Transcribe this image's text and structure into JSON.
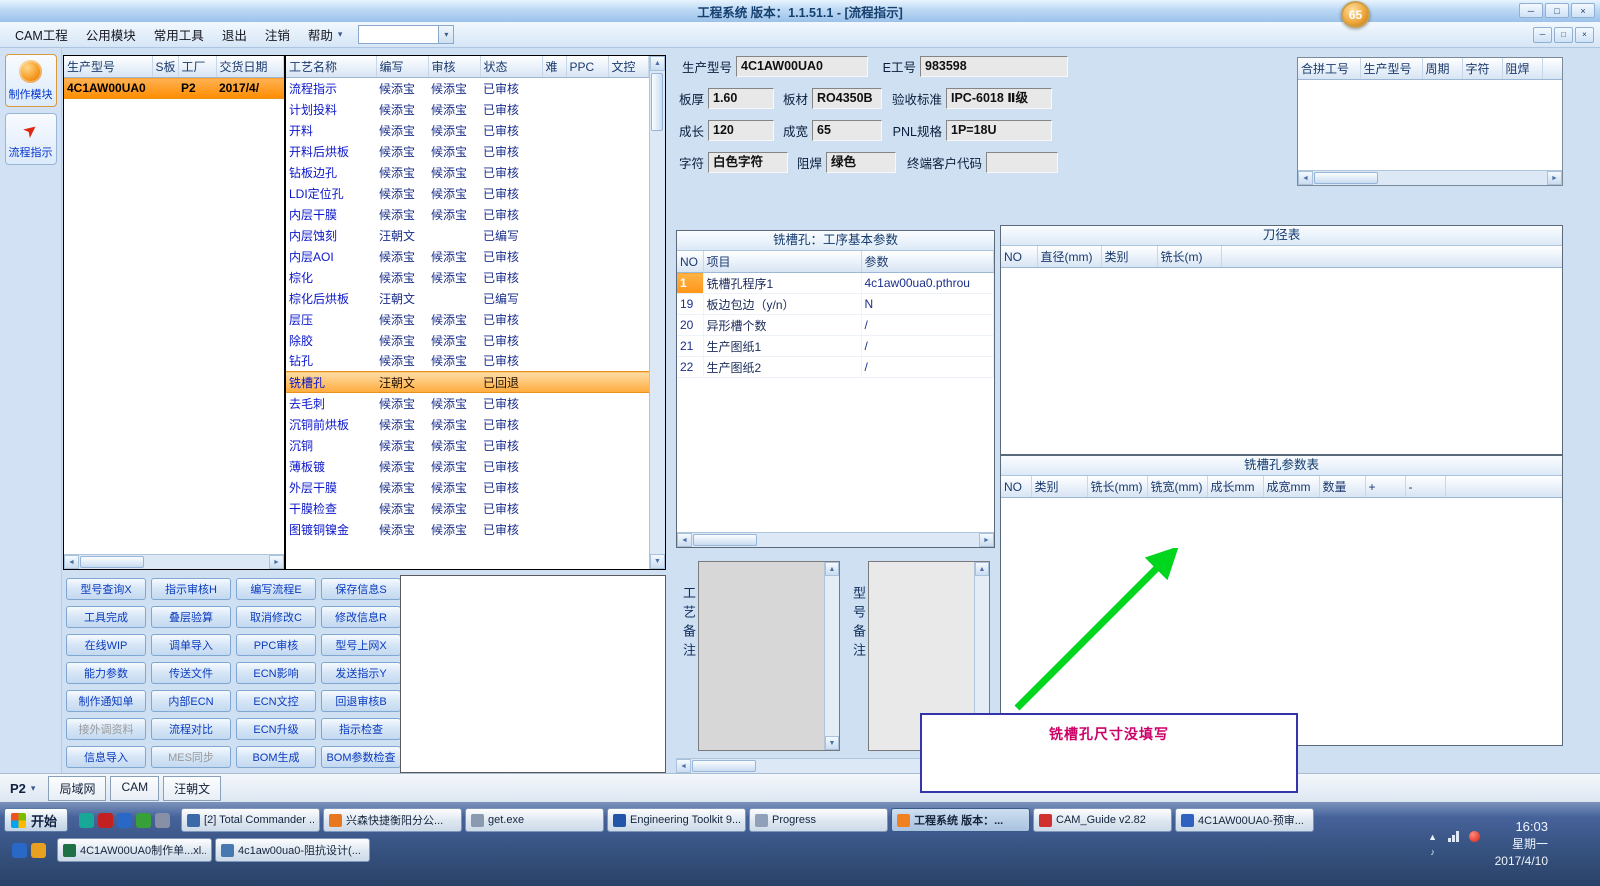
{
  "icons": {
    "minimize": "─",
    "maximize": "□",
    "close": "×",
    "dropdown": "▾",
    "left": "◄",
    "right": "►",
    "up": "▲",
    "down": "▼",
    "flow_arrow": "➤",
    "tray_up": "▲",
    "speaker": "♪"
  },
  "window": {
    "title": "工程系统 版本：1.1.51.1 - [流程指示]",
    "badge": "65"
  },
  "menubar": {
    "items": [
      "CAM工程",
      "公用模块",
      "常用工具",
      "退出",
      "注销",
      "帮助"
    ]
  },
  "sidebar": {
    "items": [
      {
        "label": "制作模块"
      },
      {
        "label": "流程指示"
      }
    ]
  },
  "model_table": {
    "columns": [
      "生产型号",
      "S板",
      "工厂",
      "交货日期"
    ],
    "rows": [
      [
        "4C1AW00UA0",
        "",
        "P2",
        "2017/4/"
      ]
    ]
  },
  "process_table": {
    "columns": [
      "工艺名称",
      "编写",
      "审核",
      "状态",
      "难",
      "PPC",
      "文控"
    ],
    "rows": [
      [
        "流程指示",
        "候添宝",
        "候添宝",
        "已审核",
        "",
        "",
        ""
      ],
      [
        "计划投料",
        "候添宝",
        "候添宝",
        "已审核",
        "",
        "",
        ""
      ],
      [
        "开料",
        "候添宝",
        "候添宝",
        "已审核",
        "",
        "",
        ""
      ],
      [
        "开料后烘板",
        "候添宝",
        "候添宝",
        "已审核",
        "",
        "",
        ""
      ],
      [
        "钻板边孔",
        "候添宝",
        "候添宝",
        "已审核",
        "",
        "",
        ""
      ],
      [
        "LDI定位孔",
        "候添宝",
        "候添宝",
        "已审核",
        "",
        "",
        ""
      ],
      [
        "内层干膜",
        "候添宝",
        "候添宝",
        "已审核",
        "",
        "",
        ""
      ],
      [
        "内层蚀刻",
        "汪朝文",
        "",
        "已编写",
        "",
        "",
        ""
      ],
      [
        "内层AOI",
        "候添宝",
        "候添宝",
        "已审核",
        "",
        "",
        ""
      ],
      [
        "棕化",
        "候添宝",
        "候添宝",
        "已审核",
        "",
        "",
        ""
      ],
      [
        "棕化后烘板",
        "汪朝文",
        "",
        "已编写",
        "",
        "",
        ""
      ],
      [
        "层压",
        "候添宝",
        "候添宝",
        "已审核",
        "",
        "",
        ""
      ],
      [
        "除胶",
        "候添宝",
        "候添宝",
        "已审核",
        "",
        "",
        ""
      ],
      [
        "钻孔",
        "候添宝",
        "候添宝",
        "已审核",
        "",
        "",
        ""
      ],
      [
        "铣槽孔",
        "汪朝文",
        "",
        "已回退",
        "",
        "",
        ""
      ],
      [
        "去毛刺",
        "候添宝",
        "候添宝",
        "已审核",
        "",
        "",
        ""
      ],
      [
        "沉铜前烘板",
        "候添宝",
        "候添宝",
        "已审核",
        "",
        "",
        ""
      ],
      [
        "沉铜",
        "候添宝",
        "候添宝",
        "已审核",
        "",
        "",
        ""
      ],
      [
        "薄板镀",
        "候添宝",
        "候添宝",
        "已审核",
        "",
        "",
        ""
      ],
      [
        "外层干膜",
        "候添宝",
        "候添宝",
        "已审核",
        "",
        "",
        ""
      ],
      [
        "干膜检查",
        "候添宝",
        "候添宝",
        "已审核",
        "",
        "",
        ""
      ],
      [
        "图镀铜镍金",
        "候添宝",
        "候添宝",
        "已审核",
        "",
        "",
        ""
      ]
    ]
  },
  "details": {
    "product_model": {
      "label": "生产型号",
      "value": "4C1AW00UA0"
    },
    "e_number": {
      "label": "E工号",
      "value": "983598"
    },
    "board_thickness": {
      "label": "板厚",
      "value": "1.60"
    },
    "board_material": {
      "label": "板材",
      "value": "RO4350B"
    },
    "acceptance_standard": {
      "label": "验收标准",
      "value": "IPC-6018 Ⅱ级"
    },
    "finished_length": {
      "label": "成长",
      "value": "120"
    },
    "finished_width": {
      "label": "成宽",
      "value": "65"
    },
    "pnl_spec": {
      "label": "PNL规格",
      "value": "1P=18U"
    },
    "legend": {
      "label": "字符",
      "value": "白色字符"
    },
    "solder_mask": {
      "label": "阻焊",
      "value": "绿色"
    },
    "end_customer_code": {
      "label": "终端客户代码",
      "value": ""
    }
  },
  "pair_table": {
    "columns": [
      "合拼工号",
      "生产型号",
      "周期",
      "字符",
      "阻焊"
    ],
    "rows": []
  },
  "param_panel": {
    "title": "铣槽孔：工序基本参数",
    "columns": [
      "NO",
      "项目",
      "参数"
    ],
    "rows": [
      [
        "1",
        "铣槽孔程序1",
        "4c1aw00ua0.pthrou"
      ],
      [
        "19",
        "板边包边（y/n）",
        "N"
      ],
      [
        "20",
        "异形槽个数",
        "/"
      ],
      [
        "21",
        "生产图纸1",
        "/"
      ],
      [
        "22",
        "生产图纸2",
        "/"
      ]
    ]
  },
  "tool_table": {
    "title": "刀径表",
    "columns": [
      "NO",
      "直径(mm)",
      "类别",
      "铣长(m)"
    ],
    "rows": []
  },
  "slot_table": {
    "title": "铣槽孔参数表",
    "columns": [
      "NO",
      "类别",
      "铣长(mm)",
      "铣宽(mm)",
      "成长mm",
      "成宽mm",
      "数量",
      "+",
      "-"
    ],
    "rows": []
  },
  "command_buttons": [
    {
      "label": "型号查询X"
    },
    {
      "label": "指示审核H"
    },
    {
      "label": "编写流程E"
    },
    {
      "label": "保存信息S"
    },
    {
      "label": "工具完成"
    },
    {
      "label": "叠层验算"
    },
    {
      "label": "取消修改C"
    },
    {
      "label": "修改信息R"
    },
    {
      "label": "在线WIP"
    },
    {
      "label": "调单导入"
    },
    {
      "label": "PPC审核"
    },
    {
      "label": "型号上网X"
    },
    {
      "label": "能力参数"
    },
    {
      "label": "传送文件"
    },
    {
      "label": "ECN影响"
    },
    {
      "label": "发送指示Y"
    },
    {
      "label": "制作通知单"
    },
    {
      "label": "内部ECN"
    },
    {
      "label": "ECN文控"
    },
    {
      "label": "回退审核B"
    },
    {
      "label": "接外调资料",
      "disabled": true
    },
    {
      "label": "流程对比"
    },
    {
      "label": "ECN升级"
    },
    {
      "label": "指示检查"
    },
    {
      "label": "信息导入"
    },
    {
      "label": "MES同步",
      "disabled": true
    },
    {
      "label": "BOM生成"
    },
    {
      "label": "BOM参数检查"
    }
  ],
  "notes": {
    "process_note_label": "工艺备注",
    "model_note_label": "型号备注",
    "process_note_value": "",
    "model_note_value": ""
  },
  "annotation": {
    "text": "铣槽孔尺寸没填写"
  },
  "bottom_bar": {
    "factory": "P2",
    "tabs": [
      "局域网",
      "CAM",
      "汪朝文"
    ]
  },
  "taskbar": {
    "start_label": "开始",
    "quick_launch": [
      {
        "label": "",
        "color": "#18a898"
      },
      {
        "label": "",
        "color": "#c42020"
      },
      {
        "label": "",
        "color": "#2a68c8"
      },
      {
        "label": "",
        "color": "#38a038"
      },
      {
        "label": "",
        "color": "#8890a8"
      }
    ],
    "quick_launch2": [
      {
        "label": "",
        "color": "#2a68c8"
      },
      {
        "label": "",
        "color": "#e8a020"
      }
    ],
    "row1": [
      {
        "label": "[2] Total Commander ...",
        "color": "#3a6aa8"
      },
      {
        "label": "兴森快捷衡阳分公...",
        "color": "#e87820"
      },
      {
        "label": "get.exe",
        "color": "#8a9ab0"
      },
      {
        "label": "Engineering Toolkit 9...",
        "color": "#2255aa"
      },
      {
        "label": "Progress",
        "color": "#90a0b8"
      },
      {
        "label": "工程系统 版本：...",
        "color": "#f08020",
        "active": true
      },
      {
        "label": "CAM_Guide v2.82",
        "color": "#d03030"
      },
      {
        "label": "4C1AW00UA0-预审...",
        "color": "#3060c0"
      }
    ],
    "row2": [
      {
        "label": "4C1AW00UA0制作单...xl...",
        "color": "#1e7145"
      },
      {
        "label": "4c1aw00ua0-阻抗设计(...",
        "color": "#4878b0"
      }
    ],
    "tray": {
      "time": "16:03",
      "weekday": "星期一",
      "date": "2017/4/10"
    }
  }
}
